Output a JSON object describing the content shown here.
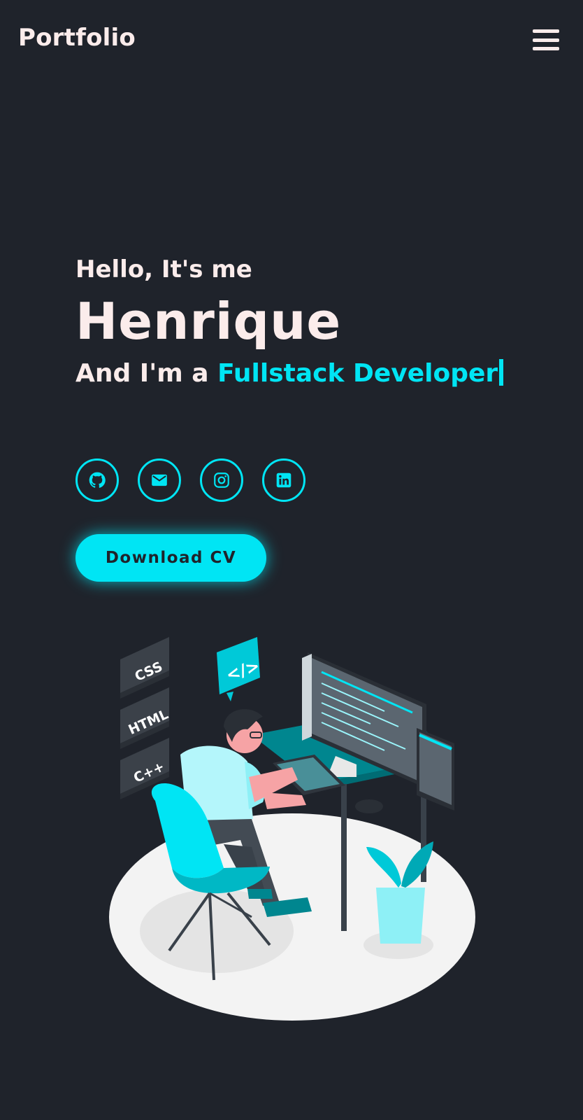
{
  "header": {
    "logo": "Portfolio",
    "menu_icon": "hamburger-menu-icon"
  },
  "hero": {
    "greeting": "Hello, It's me",
    "name": "Henrique",
    "role_prefix": "And I'm a ",
    "role_highlight": "Fullstack Developer"
  },
  "socials": [
    {
      "icon": "github-icon"
    },
    {
      "icon": "email-icon"
    },
    {
      "icon": "instagram-icon"
    },
    {
      "icon": "linkedin-icon"
    }
  ],
  "cta": {
    "download_label": "Download CV"
  },
  "illustration": {
    "badges": [
      "CSS",
      "HTML",
      "C++"
    ],
    "code_bubble": "</>"
  },
  "colors": {
    "background": "#1f232b",
    "accent": "#00e5f4",
    "text": "#fbeceb"
  }
}
